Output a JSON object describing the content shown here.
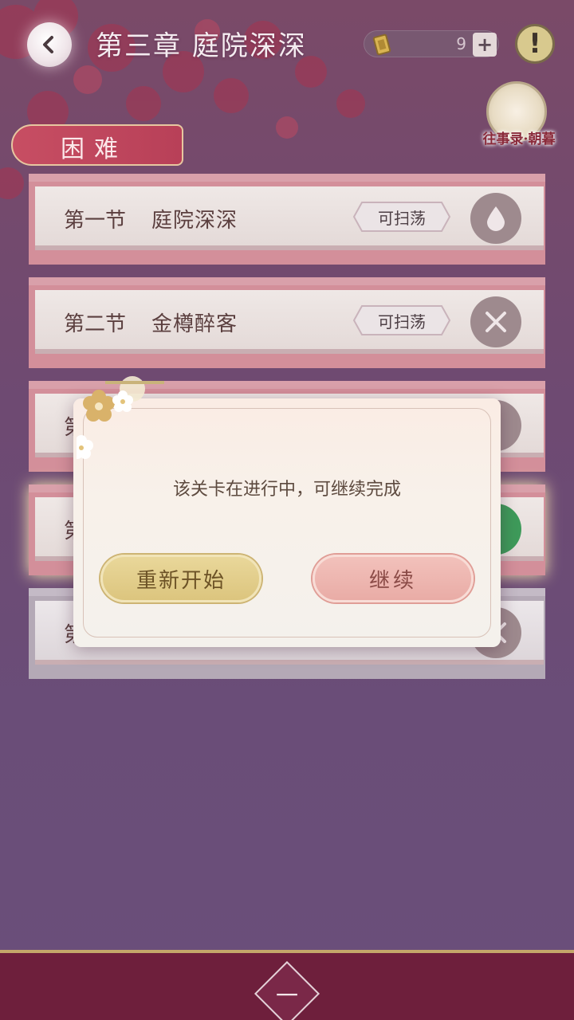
{
  "header": {
    "title": "第三章 庭院深深",
    "currency_count": "9",
    "plus_label": "+",
    "info_label": "!"
  },
  "memory": {
    "label": "往事录·朝暮"
  },
  "difficulty": {
    "label": "困难"
  },
  "stages": [
    {
      "num": "第一节",
      "name": "庭院深深",
      "sweep": "可扫荡",
      "icon": "water-drop-icon"
    },
    {
      "num": "第二节",
      "name": "金樽醉客",
      "sweep": "可扫荡",
      "icon": "crossed-swords-icon"
    },
    {
      "num": "第",
      "name": "",
      "sweep": "",
      "icon": "leaf-icon"
    },
    {
      "num": "第",
      "name": "",
      "sweep": "",
      "icon": "green-orb-icon"
    },
    {
      "num": "第",
      "name": "",
      "sweep": "",
      "icon": "crossed-swords-icon"
    }
  ],
  "dialog": {
    "message": "该关卡在进行中，可继续完成",
    "restart_label": "重新开始",
    "continue_label": "继续"
  },
  "bottom": {
    "label": "一"
  }
}
